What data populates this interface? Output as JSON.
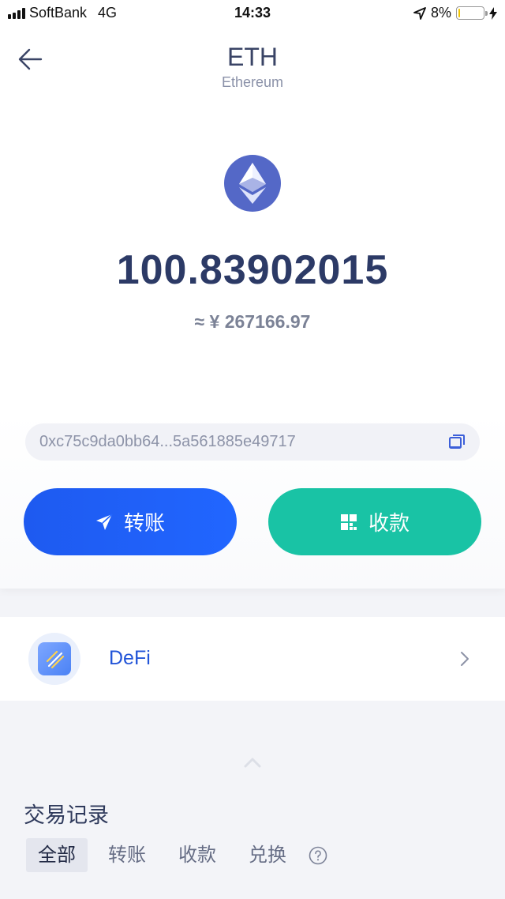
{
  "status_bar": {
    "carrier": "SoftBank",
    "network": "4G",
    "time": "14:33",
    "battery_percent": "8%",
    "battery_level": 0.08
  },
  "header": {
    "title": "ETH",
    "subtitle": "Ethereum"
  },
  "coin": {
    "icon": "ethereum-icon",
    "color": "#5468c7",
    "balance": "100.83902015",
    "fiat_value": "≈ ¥ 267166.97"
  },
  "address": {
    "value": "0xc75c9da0bb64...5a561885e49717"
  },
  "actions": {
    "transfer_label": "转账",
    "transfer_color": "#1e5af0",
    "receive_label": "收款",
    "receive_color": "#19c3a5"
  },
  "defi": {
    "label": "DeFi"
  },
  "history": {
    "title": "交易记录",
    "tabs": [
      {
        "label": "全部",
        "active": true
      },
      {
        "label": "转账",
        "active": false
      },
      {
        "label": "收款",
        "active": false
      },
      {
        "label": "兑换",
        "active": false
      }
    ]
  }
}
